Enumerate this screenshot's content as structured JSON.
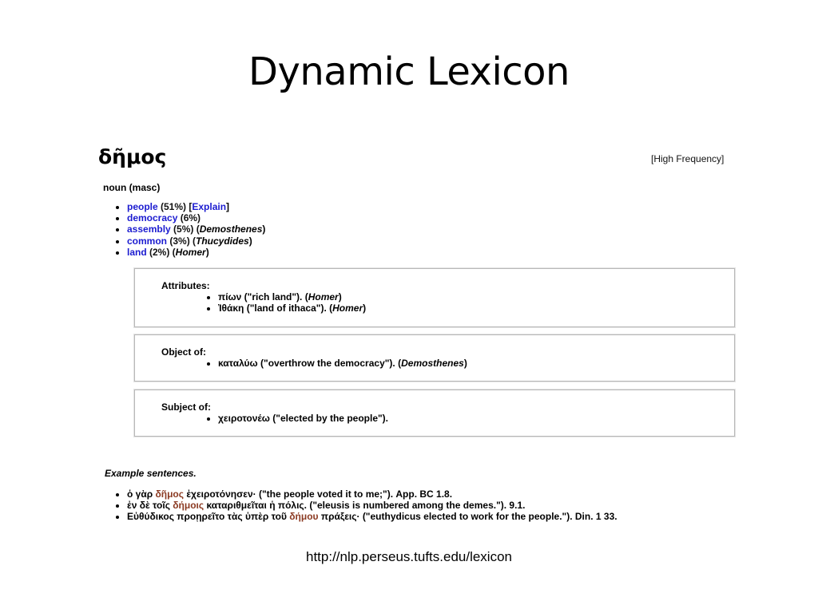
{
  "slide": {
    "title": "Dynamic Lexicon",
    "source_url": "http://nlp.perseus.tufts.edu/lexicon"
  },
  "entry": {
    "headword": "δῆμος",
    "frequency_badge": "[High Frequency]",
    "pos": "noun (masc)",
    "link_color": "#1b1bd0",
    "highlight_color": "#8b3a22",
    "meanings": [
      {
        "word": "people",
        "pct": " (51%) [",
        "extra_link": "Explain",
        "tail": "]"
      },
      {
        "word": "democracy",
        "pct": " (6%)"
      },
      {
        "word": "assembly",
        "pct": " (5%) (",
        "author": "Demosthenes",
        "tail": ")"
      },
      {
        "word": "common",
        "pct": " (3%) (",
        "author": "Thucydides",
        "tail": ")"
      },
      {
        "word": "land",
        "pct": " (2%) (",
        "author": "Homer",
        "tail": ")"
      }
    ]
  },
  "relations": {
    "attributes": {
      "label": "Attributes:",
      "items": [
        {
          "text": "πίων (\"rich land\"). (",
          "author": "Homer",
          "tail": ")"
        },
        {
          "text": "Ἰθάκη (\"land of ithaca\"). (",
          "author": "Homer",
          "tail": ")"
        }
      ]
    },
    "object_of": {
      "label": "Object of:",
      "items": [
        {
          "text": "καταλύω (\"overthrow the democracy\"). (",
          "author": "Demosthenes",
          "tail": ")"
        }
      ]
    },
    "subject_of": {
      "label": "Subject of:",
      "items": [
        {
          "text": "χειροτονέω (\"elected by the people\")."
        }
      ]
    }
  },
  "examples": {
    "label": "Example sentences.",
    "items": [
      {
        "pre": "ὁ γὰρ ",
        "hl": "δῆμος",
        "post": " ἐχειροτόνησεν· (\"the people voted it to me;\"). App. BC 1.8."
      },
      {
        "pre": "ἐν δὲ τοῖς ",
        "hl": "δήμοις",
        "post": " καταριθμεῖται ἡ πόλις. (\"eleusis is numbered among the demes.\"). 9.1."
      },
      {
        "pre": "Εὐθύδικος προῃρεῖτο τὰς ὑπὲρ τοῦ ",
        "hl": "δήμου",
        "post": " πράξεις· (\"euthydicus elected to work for the people.\"). Din. 1 33."
      }
    ]
  }
}
